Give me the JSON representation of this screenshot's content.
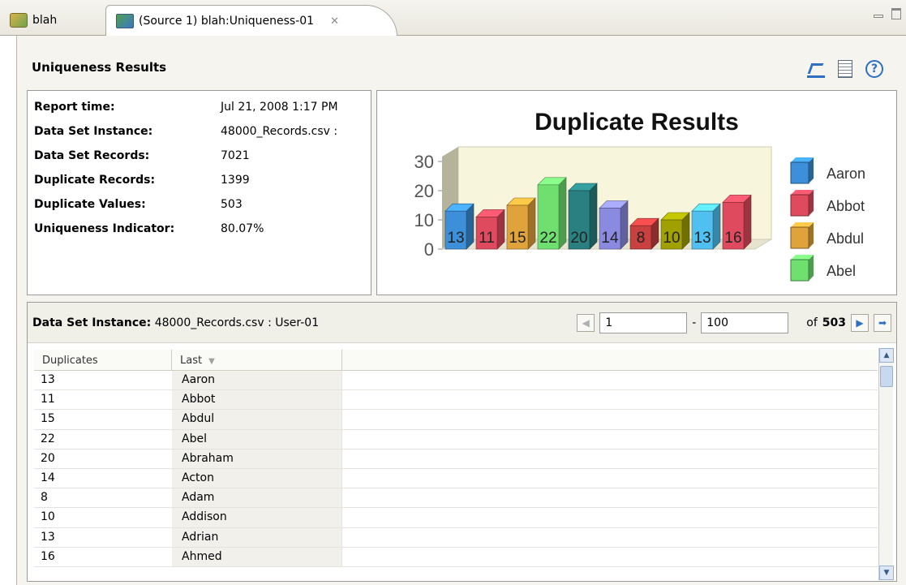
{
  "tabs": [
    {
      "label": "blah",
      "icon": "blah-table-icon"
    },
    {
      "label": "(Source 1) blah:Uniqueness-01",
      "icon": "source-data-icon",
      "close_glyph": "✕"
    }
  ],
  "header": {
    "title": "Uniqueness Results",
    "toolbar": {
      "export_icon": "export-icon",
      "report_icon": "report-icon",
      "help_icon": "help-icon",
      "help_glyph": "?"
    }
  },
  "summary": [
    {
      "label": "Report time:",
      "value": "Jul 21, 2008 1:17 PM"
    },
    {
      "label": "Data Set Instance:",
      "value": "48000_Records.csv :"
    },
    {
      "label": "Data Set Records:",
      "value": "7021"
    },
    {
      "label": "Duplicate Records:",
      "value": "1399"
    },
    {
      "label": "Duplicate Values:",
      "value": "503"
    },
    {
      "label": "Uniqueness Indicator:",
      "value": "80.07%"
    }
  ],
  "chart_data": {
    "type": "bar",
    "title": "Duplicate Results",
    "xlabel": "",
    "ylabel": "",
    "ylim": [
      0,
      30
    ],
    "yticks": [
      "0",
      "10",
      "20",
      "30"
    ],
    "categories": [
      "Aaron",
      "Abbot",
      "Abdul",
      "Abel",
      "Abraham",
      "Acton",
      "Adam",
      "Addison",
      "Adrian",
      "Ahmed"
    ],
    "values": [
      13,
      11,
      15,
      22,
      20,
      14,
      8,
      10,
      13,
      16
    ],
    "colors": [
      "#3c8fd8",
      "#e04a5e",
      "#e0a23a",
      "#6fe06f",
      "#2a8080",
      "#8a8ae0",
      "#c84040",
      "#a0a000",
      "#50c0f0",
      "#e04a5e"
    ],
    "legend": [
      {
        "label": "Aaron",
        "color": "#3c8fd8"
      },
      {
        "label": "Abbot",
        "color": "#e04a5e"
      },
      {
        "label": "Abdul",
        "color": "#e0a23a"
      },
      {
        "label": "Abel",
        "color": "#6fe06f"
      }
    ],
    "legend_position": "right",
    "three_d": true
  },
  "dataset": {
    "label": "Data Set Instance:",
    "value": "48000_Records.csv : User-01",
    "pager": {
      "from": "1",
      "to": "100",
      "of_label": "of",
      "total": "503",
      "dash": "-"
    }
  },
  "table": {
    "columns": [
      "Duplicates",
      "Last"
    ],
    "sort_glyph": "▼",
    "rows": [
      {
        "duplicates": "13",
        "last": "Aaron"
      },
      {
        "duplicates": "11",
        "last": "Abbot"
      },
      {
        "duplicates": "15",
        "last": "Abdul"
      },
      {
        "duplicates": "22",
        "last": "Abel"
      },
      {
        "duplicates": "20",
        "last": "Abraham"
      },
      {
        "duplicates": "14",
        "last": "Acton"
      },
      {
        "duplicates": "8",
        "last": "Adam"
      },
      {
        "duplicates": "10",
        "last": "Addison"
      },
      {
        "duplicates": "13",
        "last": "Adrian"
      },
      {
        "duplicates": "16",
        "last": "Ahmed"
      }
    ]
  }
}
